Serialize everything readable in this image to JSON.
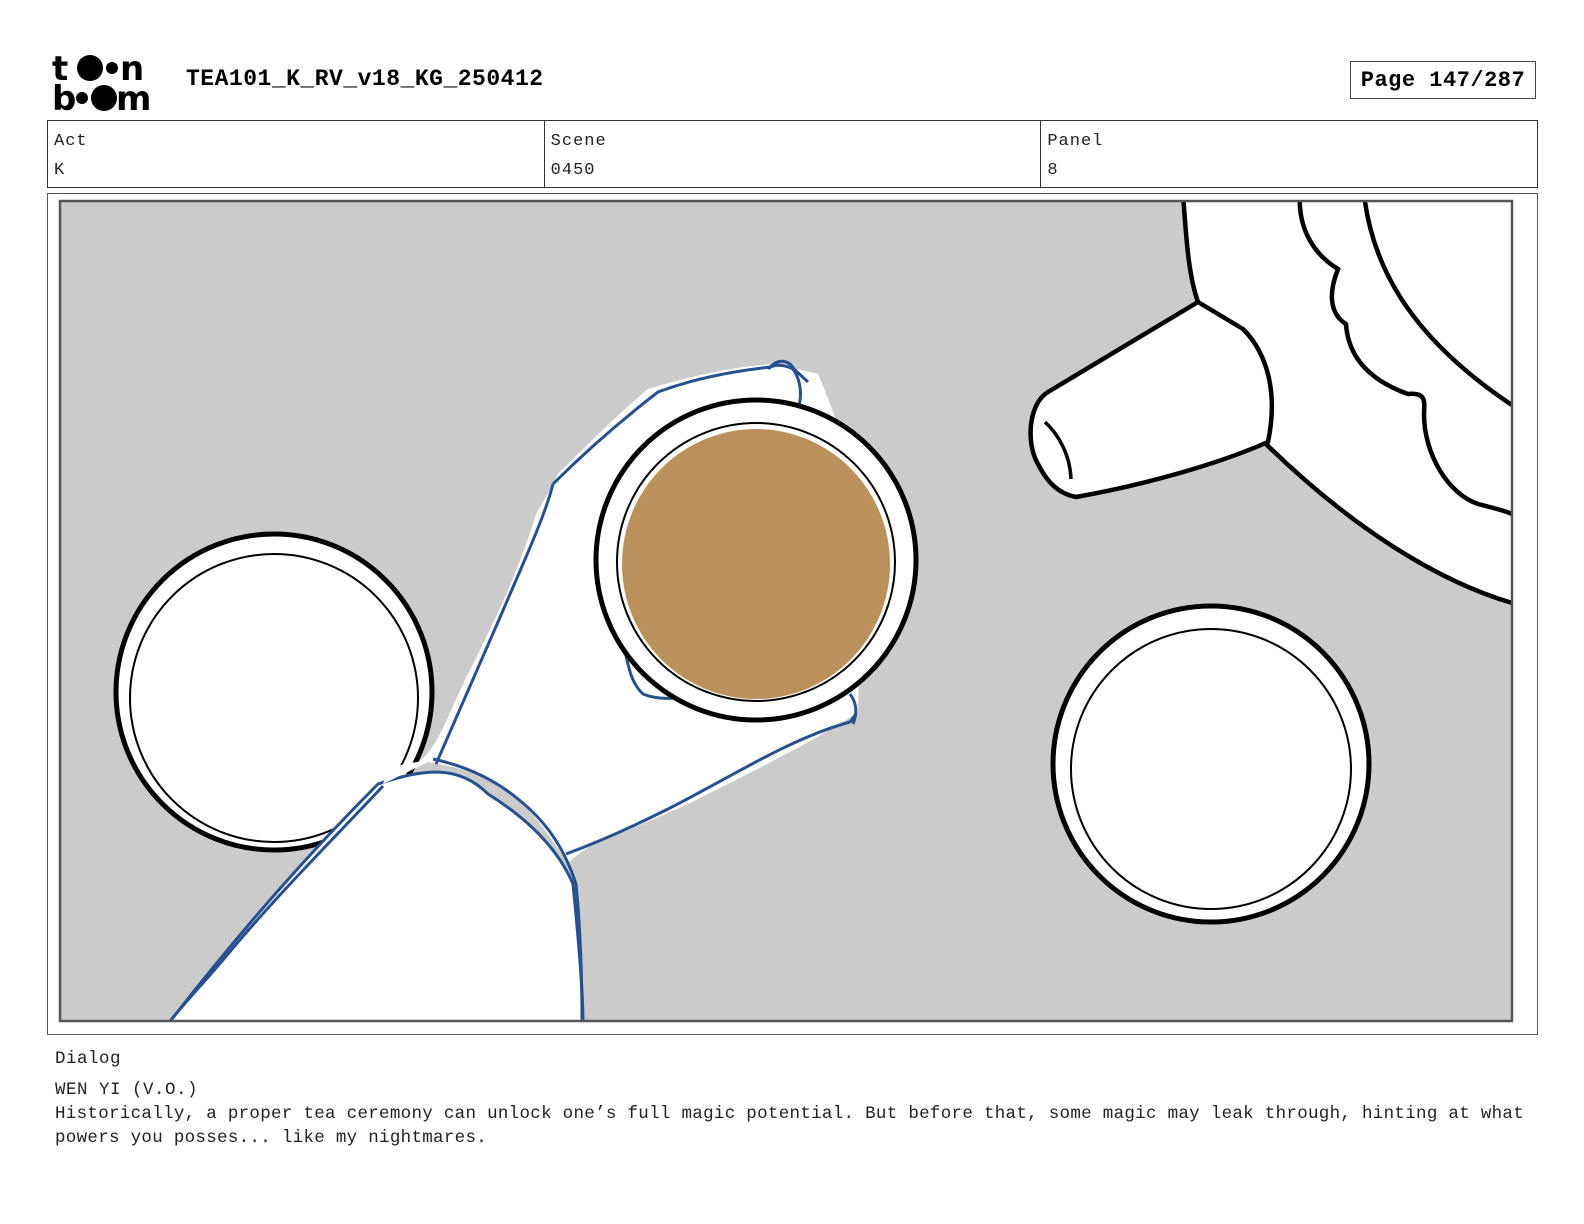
{
  "header": {
    "logo_text": "toon boom",
    "doc_title": "TEA101_K_RV_v18_KG_250412",
    "page_label": "Page 147/287"
  },
  "info": {
    "act": {
      "label": "Act",
      "value": "K"
    },
    "scene": {
      "label": "Scene",
      "value": "0450"
    },
    "panel": {
      "label": "Panel",
      "value": "8"
    }
  },
  "panel_art": {
    "background_color": "#cbcbcb",
    "tea_color": "#bb915b",
    "hand_outline_color": "#27508f",
    "line_color": "#000000"
  },
  "dialog": {
    "heading": "Dialog",
    "speaker": "WEN YI (V.O.)",
    "text": "Historically, a proper tea ceremony can unlock one’s full magic potential. But before that, some magic may leak through, hinting at what powers you posses... like my nightmares."
  }
}
